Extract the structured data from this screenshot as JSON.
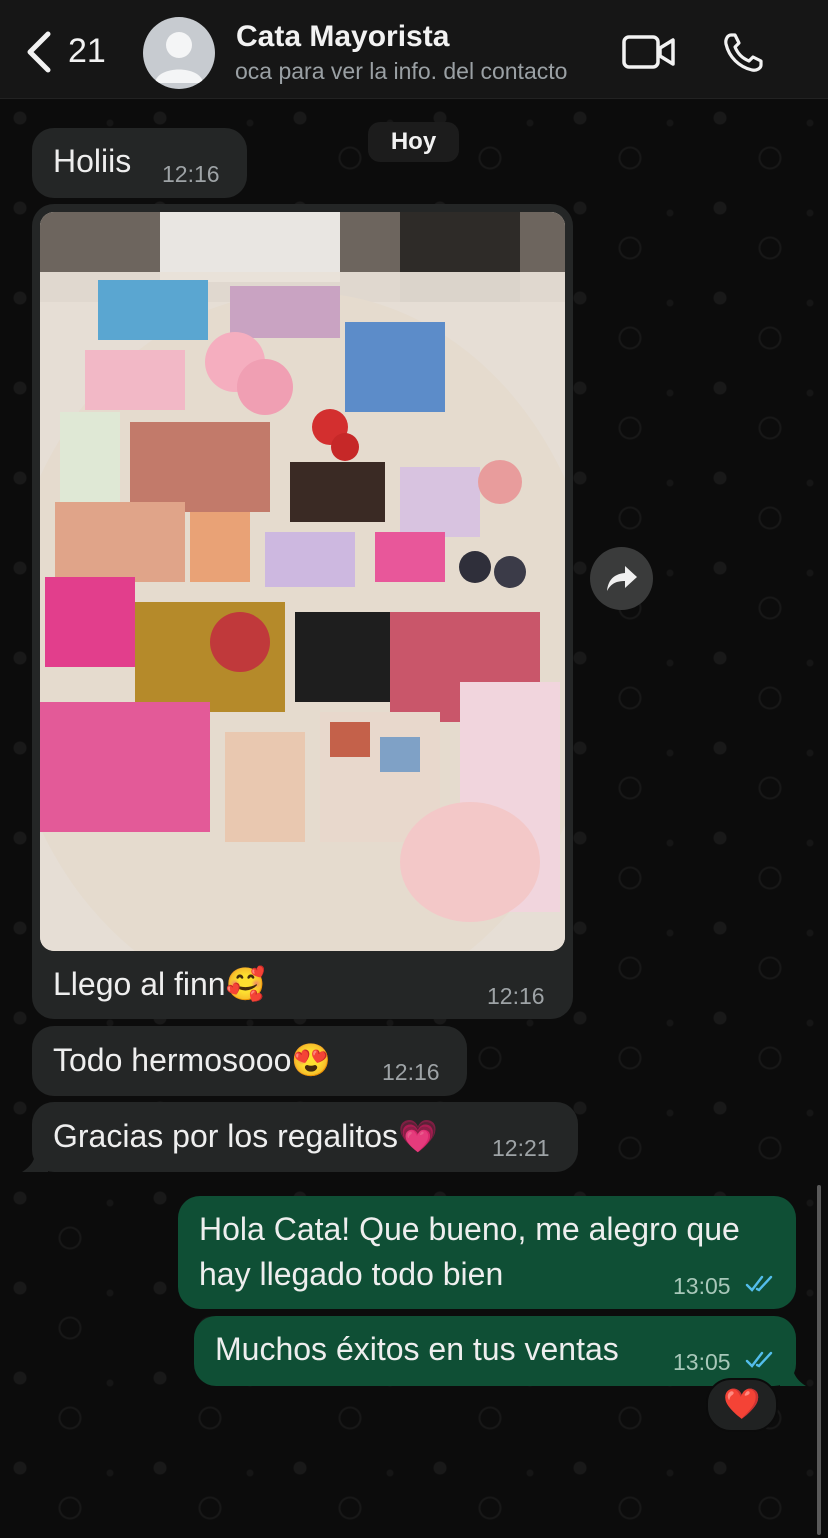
{
  "header": {
    "back_count": "21",
    "contact_name": "Cata Mayorista",
    "contact_subtitle": "oca para ver la info. del contacto",
    "icons": [
      "chevron-left-icon",
      "avatar-placeholder-icon",
      "video-call-icon",
      "phone-icon"
    ]
  },
  "chat": {
    "date_label": "Hoy",
    "messages": [
      {
        "direction": "in",
        "text": "Holiis",
        "time": "12:16"
      },
      {
        "direction": "in",
        "type": "image",
        "caption": "Llego al finn🥰",
        "time": "12:16",
        "image_alt": "cosmetics products photo"
      },
      {
        "direction": "in",
        "text": "Todo hermosooo😍",
        "time": "12:16"
      },
      {
        "direction": "in",
        "text": "Gracias por los regalitos💗",
        "time": "12:21"
      },
      {
        "direction": "out",
        "text_line1": "Hola Cata! Que bueno, me alegro que",
        "text_line2": "hay llegado todo bien",
        "time": "13:05",
        "status": "read"
      },
      {
        "direction": "out",
        "text": "Muchos éxitos en tus ventas",
        "time": "13:05",
        "status": "read",
        "reaction": "❤️"
      }
    ]
  },
  "colors": {
    "header_bg": "#161616",
    "incoming_bubble": "#242626",
    "outgoing_bubble": "#0f4f35",
    "read_ticks": "#53bdeb"
  }
}
